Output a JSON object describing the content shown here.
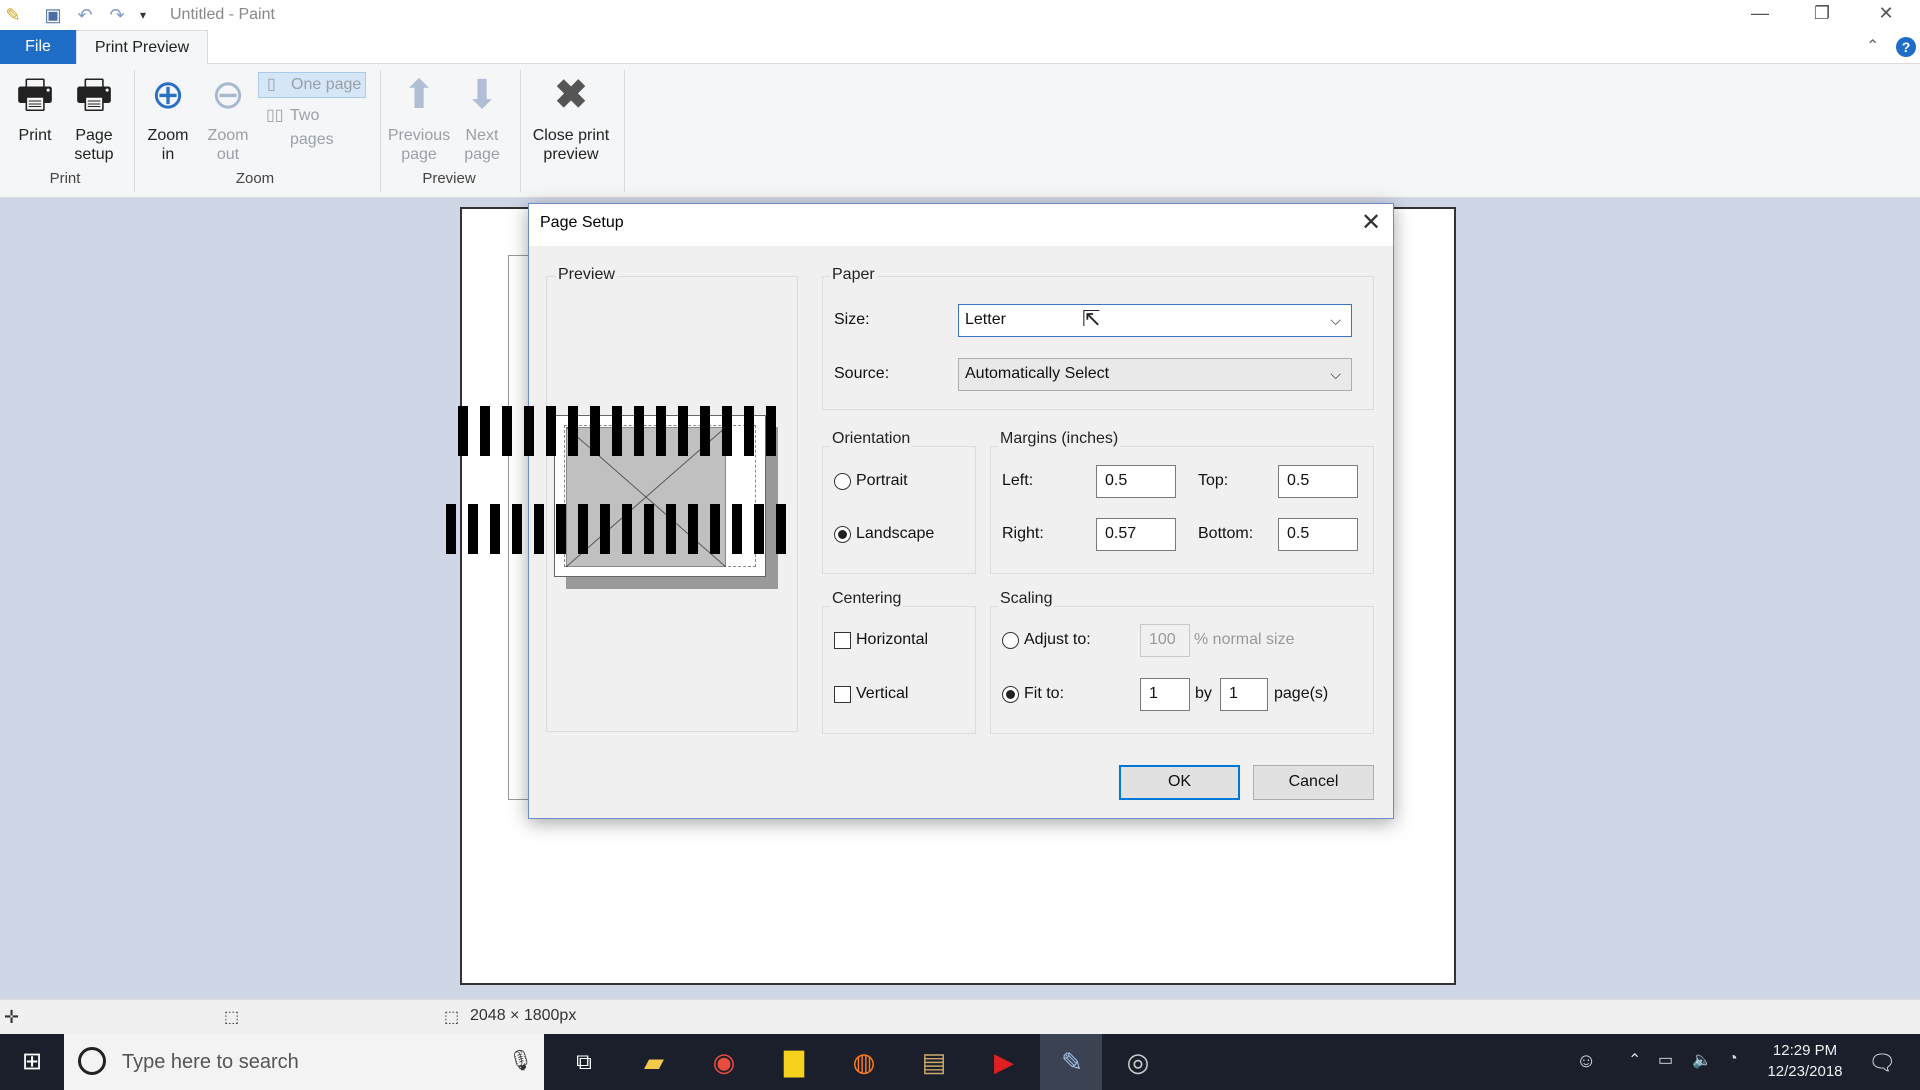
{
  "window": {
    "title": "Untitled - Paint"
  },
  "tabs": {
    "file": "File",
    "print_preview": "Print Preview"
  },
  "ribbon": {
    "print": "Print",
    "page_setup": [
      "Page",
      "setup"
    ],
    "zoom_in": [
      "Zoom",
      "in"
    ],
    "zoom_out": [
      "Zoom",
      "out"
    ],
    "one_page": "One page",
    "two_pages": "Two pages",
    "previous_page": [
      "Previous",
      "page"
    ],
    "next_page": [
      "Next",
      "page"
    ],
    "close_preview": [
      "Close print",
      "preview"
    ],
    "groups": {
      "print": "Print",
      "zoom": "Zoom",
      "preview": "Preview"
    }
  },
  "dialog": {
    "title": "Page Setup",
    "preview_label": "Preview",
    "paper": {
      "label": "Paper",
      "size_label": "Size:",
      "size_value": "Letter",
      "source_label": "Source:",
      "source_value": "Automatically Select"
    },
    "orientation": {
      "label": "Orientation",
      "portrait": "Portrait",
      "landscape": "Landscape",
      "selected": "landscape"
    },
    "margins": {
      "label": "Margins (inches)",
      "left_label": "Left:",
      "left": "0.5",
      "top_label": "Top:",
      "top": "0.5",
      "right_label": "Right:",
      "right": "0.57",
      "bottom_label": "Bottom:",
      "bottom": "0.5"
    },
    "centering": {
      "label": "Centering",
      "horizontal": "Horizontal",
      "vertical": "Vertical"
    },
    "scaling": {
      "label": "Scaling",
      "adjust_to": "Adjust to:",
      "adjust_value": "100",
      "normal_size": "% normal size",
      "fit_to": "Fit to:",
      "fit_w": "1",
      "by": "by",
      "fit_h": "1",
      "pages": "page(s)",
      "selected": "fit_to"
    },
    "ok": "OK",
    "cancel": "Cancel"
  },
  "status": {
    "dimensions": "2048 × 1800px"
  },
  "taskbar": {
    "search_placeholder": "Type here to search",
    "time": "12:29 PM",
    "date": "12/23/2018"
  },
  "colors": {
    "accent": "#1e6ec7",
    "taskbar": "#1a1f2b"
  }
}
